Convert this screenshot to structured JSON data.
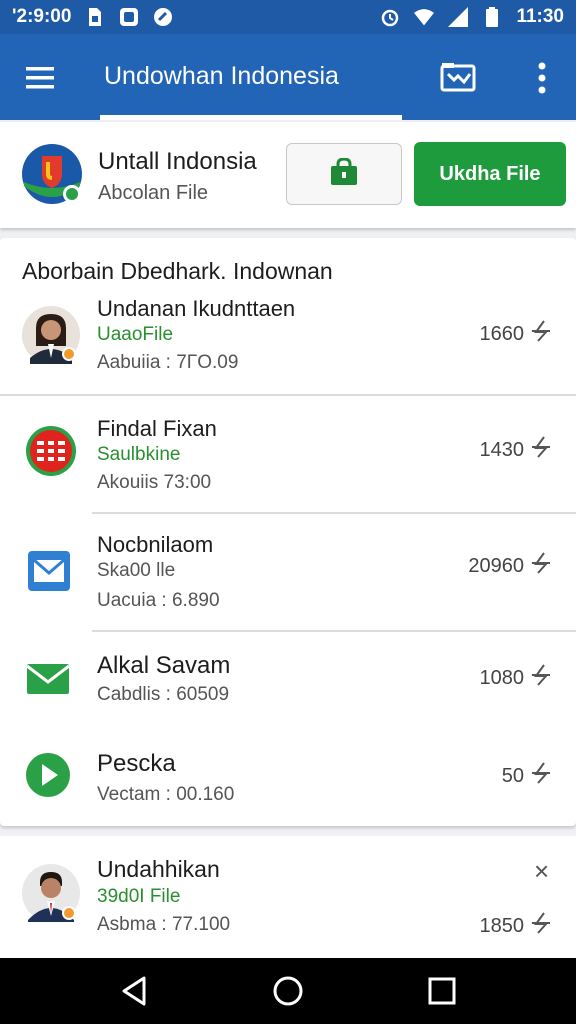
{
  "status_bar": {
    "time_left": "'2:9:00",
    "time_right": "11:30",
    "icons_left": [
      "sim-icon",
      "chat-icon",
      "sync-icon"
    ],
    "icons_right": [
      "alarm-icon",
      "wifi-icon",
      "signal-icon",
      "battery-icon"
    ]
  },
  "app_bar": {
    "title": "Undowhan Indonesia",
    "icons": [
      "menu-icon",
      "folder-icon",
      "more-icon"
    ]
  },
  "profile": {
    "name": "Untall Indonsia",
    "subtitle": "Abcolan File",
    "lock_button_icon": "shopping-bag-icon",
    "file_button_label": "Ukdha File"
  },
  "list": {
    "heading": "Aborbain Dbedhark. Indownan",
    "items": [
      {
        "title": "Undanan Ikudnttaen",
        "subtitle": "UaaoFile",
        "detail": "Aabuiia : 7ΓΟ.09",
        "amount": "1660",
        "icon": "person-avatar"
      },
      {
        "title": "Findal Fixan",
        "subtitle": "Saulbkine",
        "detail": "Akouiis 73:00",
        "amount": "1430",
        "icon": "red-logo-icon"
      },
      {
        "title": "Nocbnilaom",
        "subtitle": "Ska00 lle",
        "detail": "Uacuia : 6.890",
        "amount": "20960",
        "icon": "mail-icon"
      },
      {
        "title": "Alkal Savam",
        "subtitle": "",
        "detail": "Cabdlis : 60509",
        "amount": "1080",
        "icon": "green-mail-icon"
      },
      {
        "title": "Pescka",
        "subtitle": "",
        "detail": "Vectam : 00.160",
        "amount": "50",
        "icon": "play-icon"
      }
    ]
  },
  "bottom_item": {
    "title": "Undahhikan",
    "subtitle": "39d0I File",
    "detail": "Asbma : 77.100",
    "amount": "1850",
    "close_symbol": "×"
  },
  "colors": {
    "app_bar": "#2264b5",
    "status_bar": "#1f5aa7",
    "primary_button": "#1e9b3c",
    "accent_green": "#2a8f2f"
  }
}
